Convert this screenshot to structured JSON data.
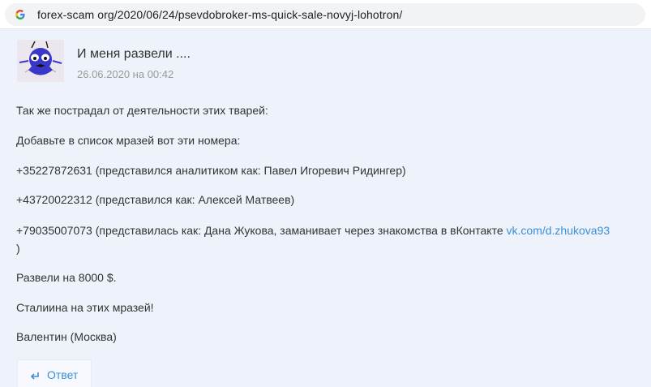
{
  "browser": {
    "url": "forex-scam org/2020/06/24/psevdobroker-ms-quick-sale-novyj-lohotron/",
    "icon": "google-g-icon"
  },
  "comment": {
    "author": "И меня развели ....",
    "date": "26.06.2020 на 00:42",
    "avatar_icon": "cartoon-creature-avatar",
    "paragraphs": [
      "Так же пострадал от деятельности этих тварей:",
      "Добавьте в список мразей вот эти номера:",
      "+35227872631 (представился аналитиком как: Павел Игоревич Ридингер)",
      "+43720022312 (представился как: Алексей Матвеев)"
    ],
    "p5_text": "+79035007073 (представилась как: Дана Жукова, заманивает через знакомства в вКонтакте ",
    "p5_link": "vk.com/d.zhukova93",
    "p5_tail": ")",
    "paragraphs_after": [
      "Развели на 8000 $.",
      "Сталиина на этих мразей!",
      "Валентин (Москва)"
    ],
    "reply_label": "Ответ",
    "reply_icon": "reply-arrow-icon"
  }
}
